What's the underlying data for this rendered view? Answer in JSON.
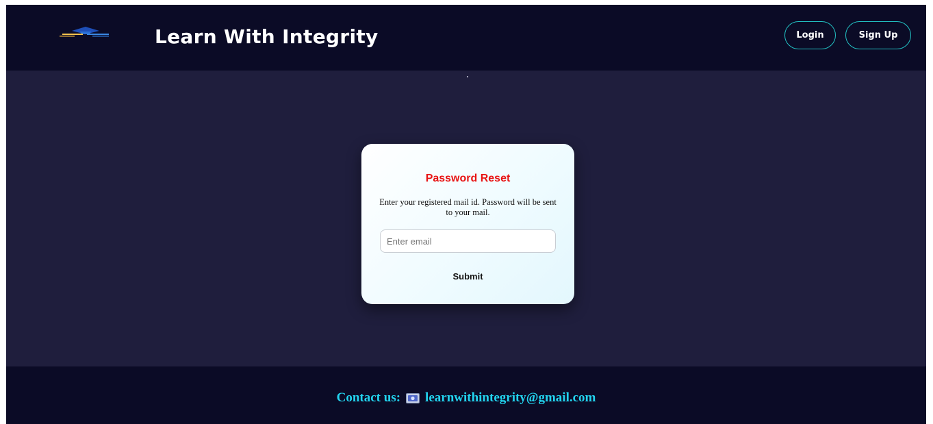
{
  "header": {
    "site_title": "Learn With Integrity",
    "login_label": "Login",
    "signup_label": "Sign Up"
  },
  "card": {
    "title": "Password Reset",
    "description": "Enter your registered mail id. Password will be sent to your mail.",
    "email_placeholder": "Enter email",
    "email_value": "",
    "submit_label": "Submit"
  },
  "footer": {
    "contact_label": "Contact us:",
    "contact_email": "learnwithintegrity@gmail.com"
  },
  "icons": {
    "logo": "graduation-cap-icon",
    "mail": "email-icon"
  },
  "colors": {
    "header_bg": "#0b0b26",
    "body_bg": "#1f1e3d",
    "accent": "#22c1c3",
    "title_red": "#e81414",
    "footer_text": "#22d3ee"
  }
}
